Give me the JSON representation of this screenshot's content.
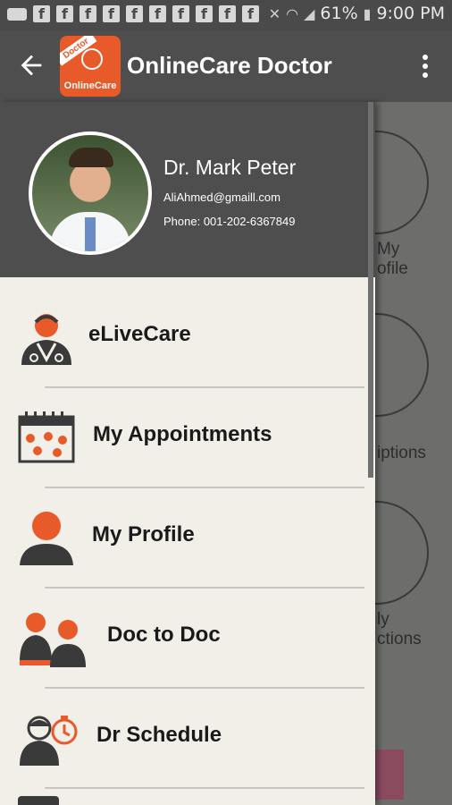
{
  "status_bar": {
    "notification_letters": [
      "f",
      "f",
      "f",
      "f",
      "f",
      "f",
      "f",
      "f",
      "f",
      "f"
    ],
    "battery": "61%",
    "time": "9:00 PM"
  },
  "app_bar": {
    "title": "OnlineCare Doctor",
    "logo_banner": "Doctor",
    "logo_text": "OnlineCare",
    "back_icon": "arrow-left-icon",
    "overflow_icon": "more-vert-icon"
  },
  "profile": {
    "name": "Dr. Mark Peter",
    "email": "AliAhmed@gmaill.com",
    "phone": "Phone: 001-202-6367849"
  },
  "menu": {
    "items": [
      {
        "label": "eLiveCare",
        "icon": "doctor-icon"
      },
      {
        "label": "My Appointments",
        "icon": "calendar-icon"
      },
      {
        "label": "My Profile",
        "icon": "person-icon"
      },
      {
        "label": "Doc to Doc",
        "icon": "doctors-pair-icon"
      },
      {
        "label": "Dr Schedule",
        "icon": "doctor-clock-icon"
      }
    ]
  },
  "background": {
    "labels": [
      "My",
      "ofile",
      "iptions",
      "ly",
      "ctions"
    ]
  },
  "colors": {
    "accent": "#e85a2a",
    "header": "#4e4e4e",
    "drawer_bg": "#f1efe8",
    "icon_dark": "#3a3a3a"
  }
}
